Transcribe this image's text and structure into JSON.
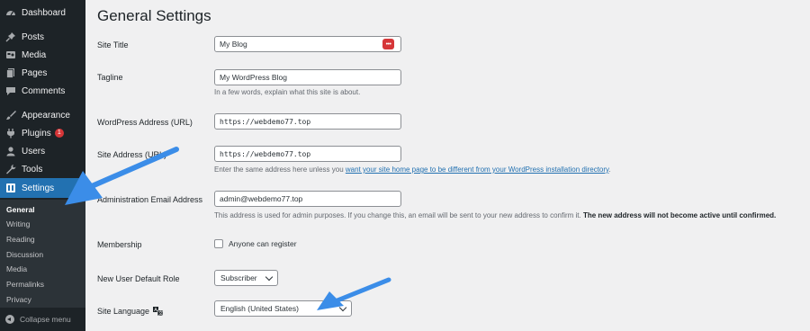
{
  "sidebar": {
    "items": [
      {
        "label": "Dashboard",
        "icon": "dashboard-icon"
      },
      {
        "label": "Posts",
        "icon": "pin-icon"
      },
      {
        "label": "Media",
        "icon": "media-icon"
      },
      {
        "label": "Pages",
        "icon": "pages-icon"
      },
      {
        "label": "Comments",
        "icon": "comments-icon"
      },
      {
        "label": "Appearance",
        "icon": "brush-icon"
      },
      {
        "label": "Plugins",
        "icon": "plugin-icon",
        "badge": "1"
      },
      {
        "label": "Users",
        "icon": "user-icon"
      },
      {
        "label": "Tools",
        "icon": "wrench-icon"
      },
      {
        "label": "Settings",
        "icon": "settings-icon"
      }
    ],
    "submenu": [
      "General",
      "Writing",
      "Reading",
      "Discussion",
      "Media",
      "Permalinks",
      "Privacy"
    ],
    "collapse_label": "Collapse menu"
  },
  "page": {
    "title": "General Settings"
  },
  "form": {
    "site_title": {
      "label": "Site Title",
      "value": "My Blog"
    },
    "tagline": {
      "label": "Tagline",
      "value": "My WordPress Blog",
      "description": "In a few words, explain what this site is about."
    },
    "wp_address": {
      "label": "WordPress Address (URL)",
      "value": "https://webdemo77.top"
    },
    "site_address": {
      "label": "Site Address (URL)",
      "value": "https://webdemo77.top",
      "description_pre": "Enter the same address here unless you ",
      "description_link": "want your site home page to be different from your WordPress installation directory",
      "description_post": "."
    },
    "admin_email": {
      "label": "Administration Email Address",
      "value": "admin@webdemo77.top",
      "description_pre": "This address is used for admin purposes. If you change this, an email will be sent to your new address to confirm it. ",
      "description_strong": "The new address will not become active until confirmed."
    },
    "membership": {
      "label": "Membership",
      "checkbox_label": "Anyone can register"
    },
    "default_role": {
      "label": "New User Default Role",
      "value": "Subscriber"
    },
    "site_language": {
      "label": "Site Language",
      "value": "English (United States)"
    }
  },
  "colors": {
    "sidebar_bg": "#1d2327",
    "accent": "#2271b1",
    "badge": "#d63638",
    "annotation_arrow": "#3b8de8"
  }
}
